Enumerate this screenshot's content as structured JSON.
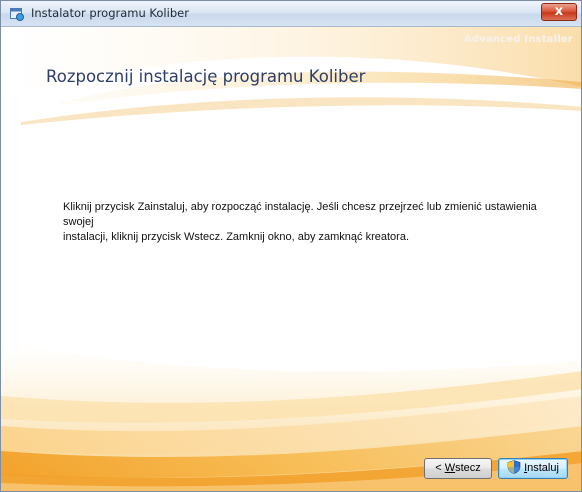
{
  "window": {
    "title": "Instalator programu Koliber",
    "close_label": "x"
  },
  "header": {
    "brand": "Advanced Installer",
    "title": "Rozpocznij instalację programu Koliber"
  },
  "content": {
    "line1": "Kliknij przycisk Zainstaluj, aby rozpocząć instalację. Jeśli chcesz przejrzeć lub zmienić ustawienia swojej",
    "line2": "instalacji, kliknij przycisk Wstecz. Zamknij okno, aby zamknąć kreatora."
  },
  "buttons": {
    "back_prefix": "< ",
    "back_mnemonic": "W",
    "back_rest": "stecz",
    "install_mnemonic": "I",
    "install_rest": "nstaluj"
  },
  "colors": {
    "title_text": "#2d3e6b",
    "swoosh_orange": "#f5a623",
    "swoosh_light": "#fde7b8"
  },
  "icons": {
    "app": "installer-icon",
    "close": "close-icon",
    "uac": "shield-icon"
  }
}
